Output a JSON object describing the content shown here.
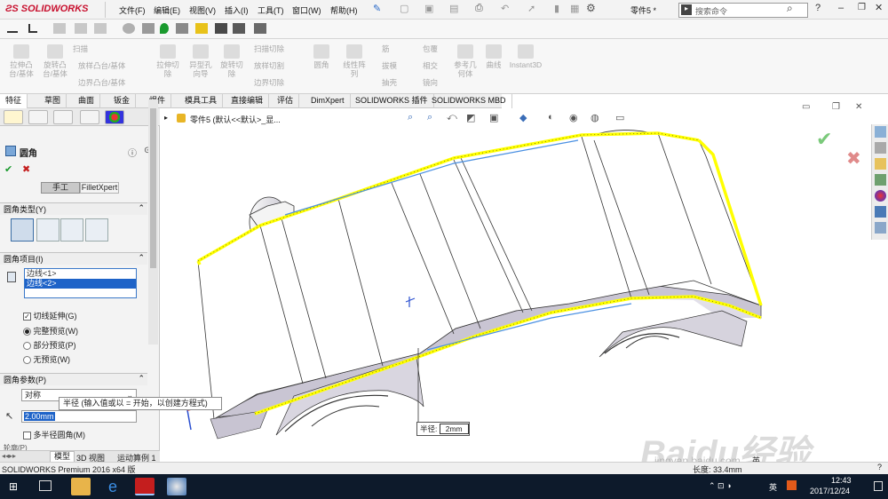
{
  "app": {
    "brand": "SOLIDWORKS",
    "doc_name": "零件5 *"
  },
  "menu": [
    "文件(F)",
    "编辑(E)",
    "视图(V)",
    "插入(I)",
    "工具(T)",
    "窗口(W)",
    "帮助(H)"
  ],
  "search": {
    "placeholder": "搜索命令"
  },
  "ribbon": {
    "groups": [
      {
        "label": "拉伸凸\n台/基体"
      },
      {
        "label": "旋转凸\n台/基体"
      },
      {
        "label": "扫描"
      },
      {
        "label": "放样凸台/基体"
      },
      {
        "label": "边界凸台/基体"
      },
      {
        "label": "拉伸切\n除"
      },
      {
        "label": "异型孔\n向导"
      },
      {
        "label": "旋转切\n除"
      },
      {
        "label": "扫描切除"
      },
      {
        "label": "放样切割"
      },
      {
        "label": "边界切除"
      },
      {
        "label": "圆角"
      },
      {
        "label": "线性阵\n列"
      },
      {
        "label": "筋"
      },
      {
        "label": "拔模"
      },
      {
        "label": "抽壳"
      },
      {
        "label": "包覆"
      },
      {
        "label": "相交"
      },
      {
        "label": "镜向"
      },
      {
        "label": "参考几\n何体"
      },
      {
        "label": "曲线"
      },
      {
        "label": "Instant3D"
      }
    ]
  },
  "tabs": [
    "特征",
    "草图",
    "曲面",
    "钣金",
    "焊件",
    "模具工具",
    "直接编辑",
    "评估",
    "DimXpert",
    "SOLIDWORKS 插件",
    "SOLIDWORKS MBD"
  ],
  "tree": {
    "label": "零件5 (默认<<默认>_显..."
  },
  "propertymanager": {
    "title": "圆角",
    "mode_manual": "手工",
    "mode_filletxpert": "FilletXpert",
    "fillet_type": {
      "title": "圆角类型(Y)"
    },
    "fillet_items": {
      "title": "圆角项目(I)",
      "edges": [
        "边线<1>",
        "边线<2>"
      ]
    },
    "tangent_propagation": "切线延伸(G)",
    "full_preview": "完整预览(W)",
    "partial_preview": "部分预览(P)",
    "no_preview": "无预览(W)",
    "fillet_params": {
      "title": "圆角参数(P)",
      "method": "对称",
      "radius": "2.00mm"
    },
    "multi_radius": "多半径圆角(M)",
    "profile": "轮廓(P)"
  },
  "tooltip": "半径 (输入值或以 = 开始，以创建方程式)",
  "callout": {
    "label": "半径:",
    "value": "2mm"
  },
  "bottom_tabs": [
    "模型",
    "3D 视图",
    "运动算例 1"
  ],
  "status": {
    "left": "SOLIDWORKS Premium 2016 x64 版",
    "right": "长度: 33.4mm"
  },
  "taskbar": {
    "time": "12:43",
    "date": "2017/12/24",
    "lang": "英"
  },
  "watermark": {
    "text": "Baidu经验",
    "url": "jingyan.baidu.com"
  },
  "colors": {
    "brand": "#c8102e",
    "selection": "#ffff00",
    "taskbar": "#0d1a2b"
  }
}
